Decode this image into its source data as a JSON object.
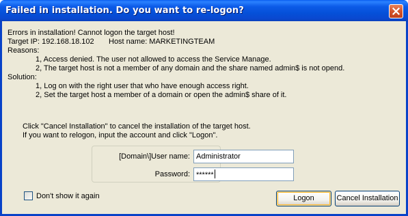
{
  "window": {
    "title": "Failed in installation. Do you want to re-logon?"
  },
  "message": {
    "line1": "Errors in installation! Cannot logon the target host!",
    "target_ip": "Target IP: 192.168.18.102",
    "host_name": "Host name: MARKETINGTEAM",
    "reasons_heading": "Reasons:",
    "reason1": "1, Access denied. The user not allowed to access the Service Manage.",
    "reason2": "2, The target host is not a member of any domain and the share named admin$ is not opend.",
    "solution_heading": "Solution:",
    "solution1": "1, Log on with the right user that who have enough access right.",
    "solution2": "2, Set the target host a member of a domain or open the admin$ share of it."
  },
  "instructions": {
    "line1": "Click \"Cancel Installation\" to cancel the installation of the target host.",
    "line2": "If you want to relogon, input the account and click \"Logon\"."
  },
  "form": {
    "username_label": "[Domain\\]User name:",
    "username_value": "Administrator",
    "password_label": "Password:",
    "password_value": "******"
  },
  "options": {
    "dont_show_label": "Don't show it again",
    "dont_show_checked": false
  },
  "buttons": {
    "logon": "Logon",
    "cancel_installation": "Cancel Installation"
  },
  "icons": {
    "close": "close-icon"
  }
}
